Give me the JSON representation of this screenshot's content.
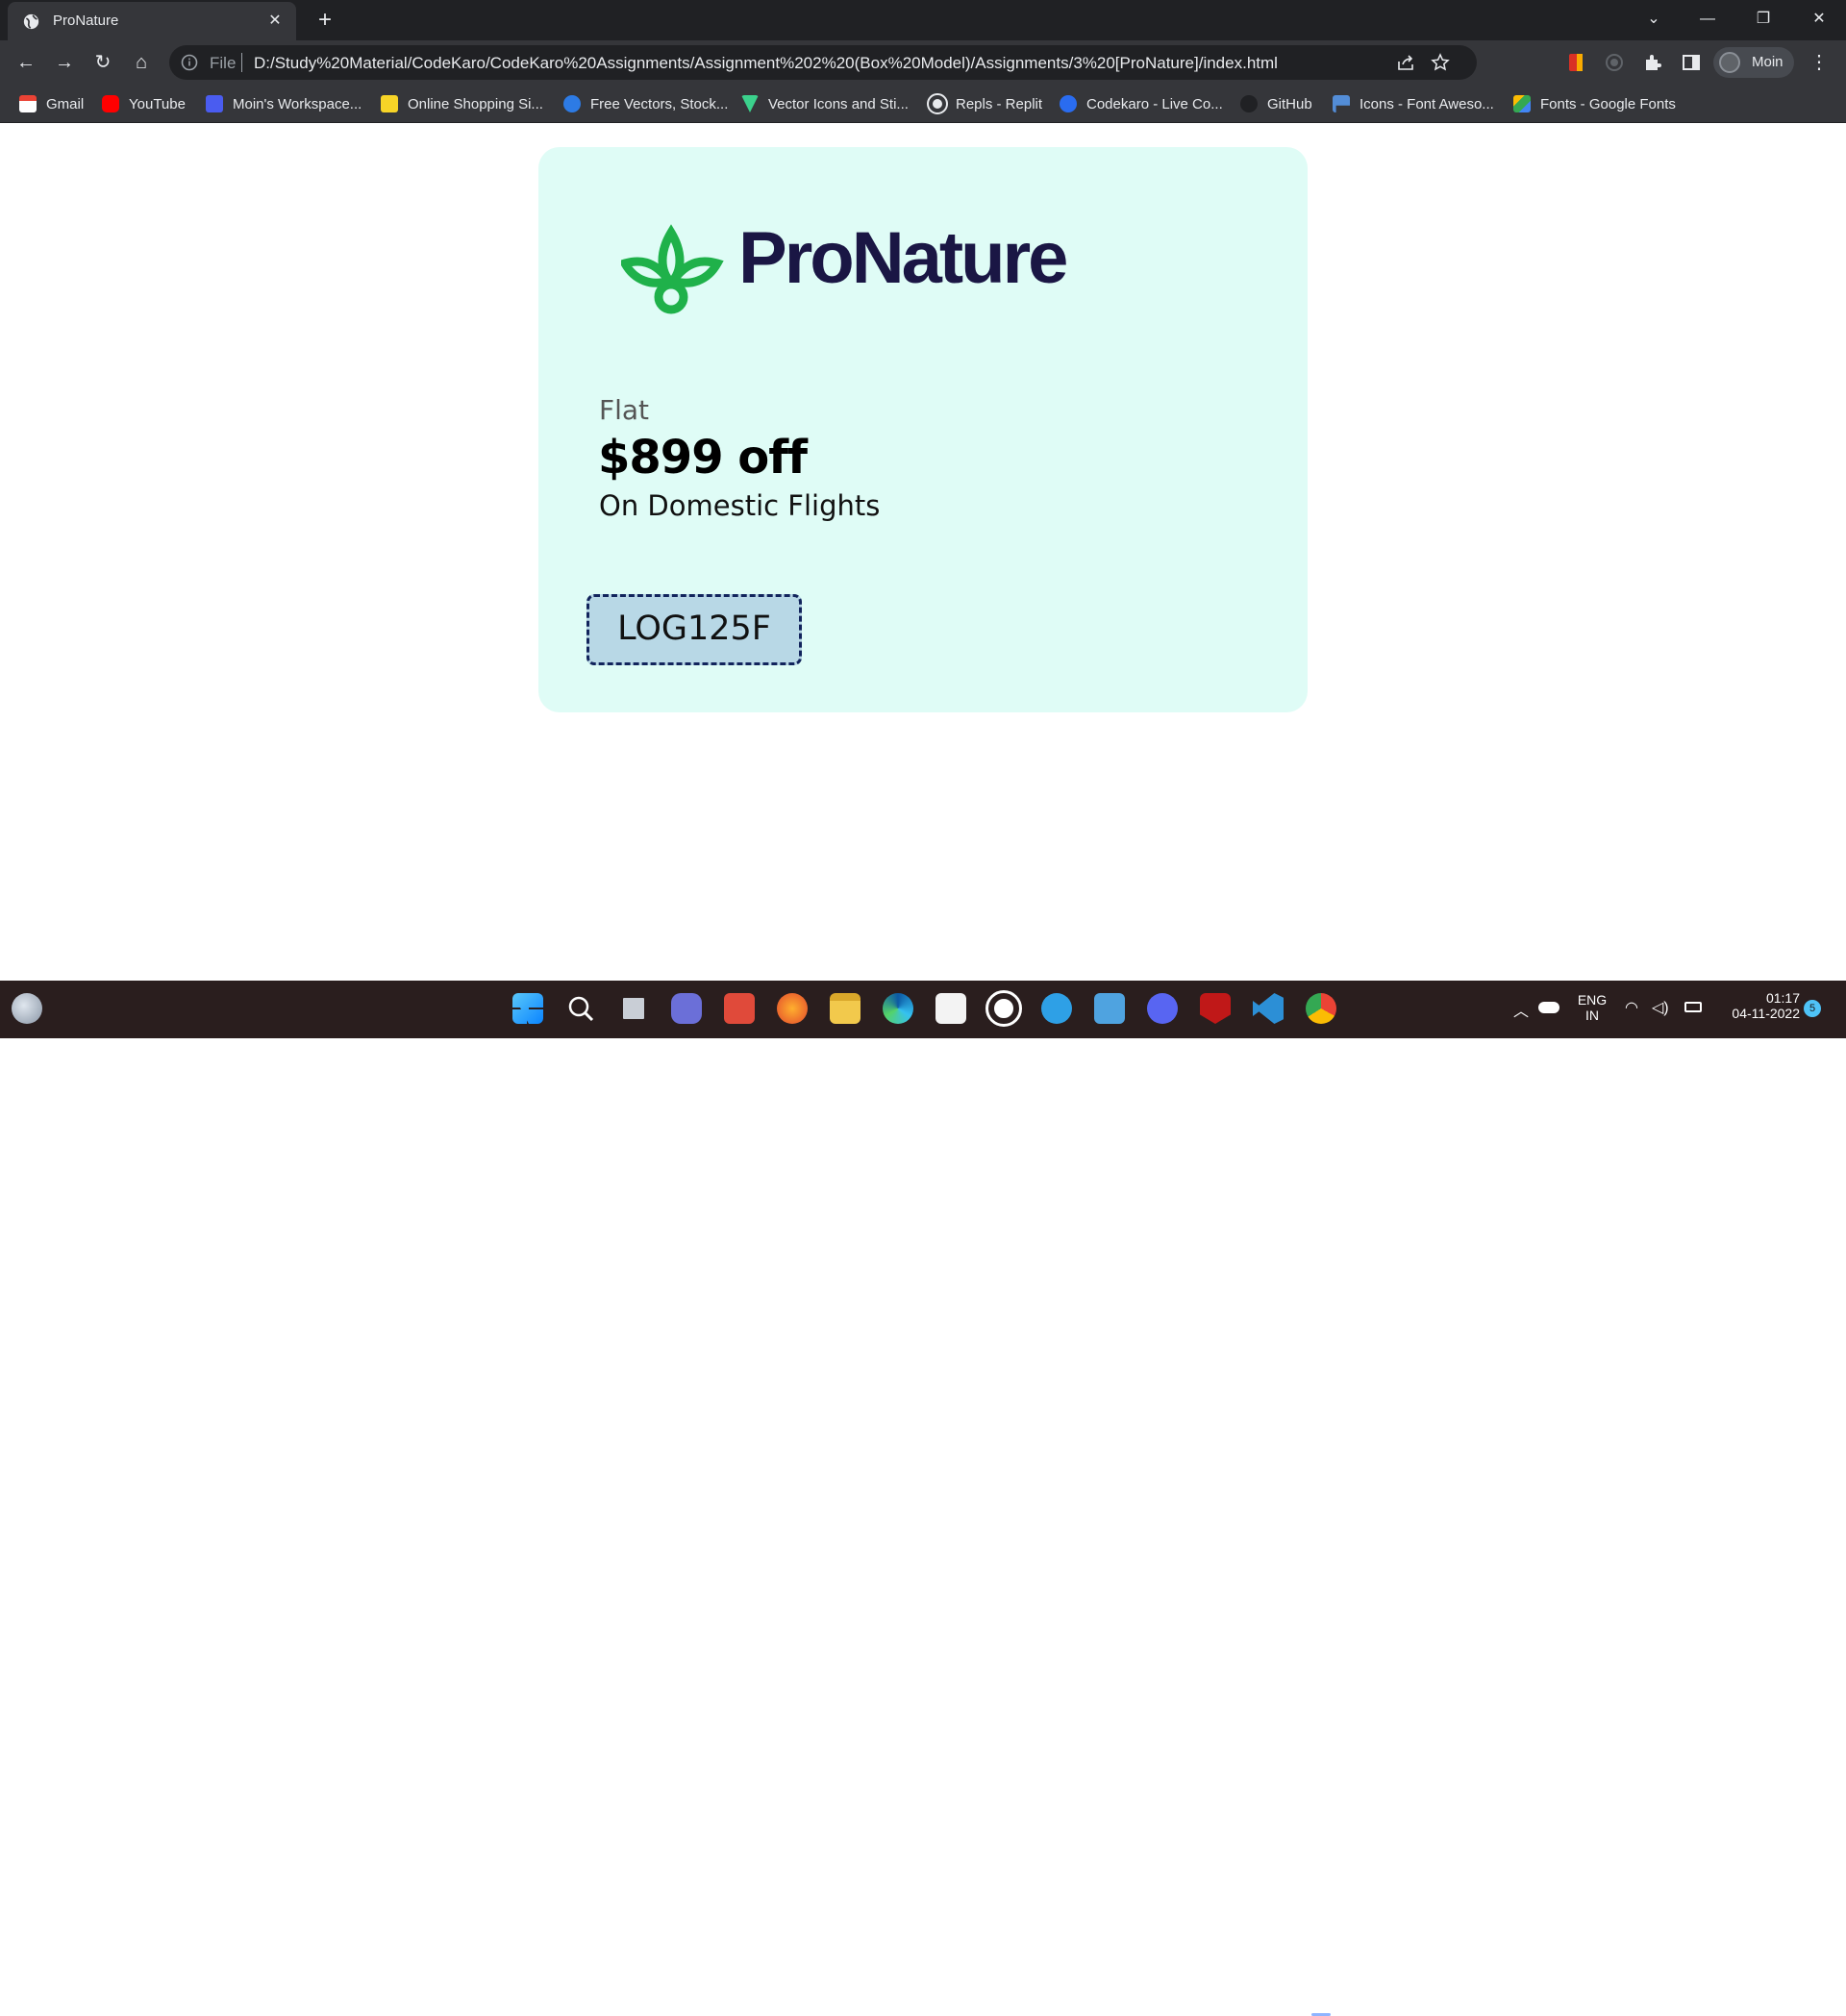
{
  "browser": {
    "tab_title": "ProNature",
    "url_scheme": "File",
    "url": "D:/Study%20Material/CodeKaro/CodeKaro%20Assignments/Assignment%202%20(Box%20Model)/Assignments/3%20[ProNature]/index.html",
    "profile_name": "Moin"
  },
  "bookmarks": [
    {
      "label": "Gmail",
      "icon": "gmail-icon",
      "color": "#ea4335"
    },
    {
      "label": "YouTube",
      "icon": "youtube-icon",
      "color": "#ff0000"
    },
    {
      "label": "Moin's Workspace...",
      "icon": "workspace-icon",
      "color": "#4a5cf0"
    },
    {
      "label": "Online Shopping Si...",
      "icon": "flipkart-icon",
      "color": "#f7d427"
    },
    {
      "label": "Free Vectors, Stock...",
      "icon": "freepik-icon",
      "color": "#2d7be5"
    },
    {
      "label": "Vector Icons and Sti...",
      "icon": "flaticon-icon",
      "color": "#3bd18c"
    },
    {
      "label": "Repls - Replit",
      "icon": "replit-icon",
      "color": "#e8eaed"
    },
    {
      "label": "Codekaro - Live Co...",
      "icon": "codekaro-icon",
      "color": "#2a6cf0"
    },
    {
      "label": "GitHub",
      "icon": "github-icon",
      "color": "#202124"
    },
    {
      "label": "Icons - Font Aweso...",
      "icon": "fontawesome-icon",
      "color": "#538dd7"
    },
    {
      "label": "Fonts - Google Fonts",
      "icon": "googlefonts-icon",
      "color": "#fbbc04"
    }
  ],
  "page": {
    "brand": "ProNature",
    "flat_label": "Flat",
    "discount": "$899 off",
    "subtitle": "On Domestic Flights",
    "coupon_code": "LOG125F",
    "colors": {
      "card_bg": "#dffcf6",
      "brand_green": "#1fb14a",
      "brand_navy": "#1a1644",
      "coupon_bg": "#b8d8e6",
      "coupon_border": "#12245c"
    }
  },
  "taskbar": {
    "apps": [
      "windows-start-icon",
      "search-icon",
      "task-view-icon",
      "teams-chat-icon",
      "power-app-icon",
      "firefox-icon",
      "file-explorer-icon",
      "edge-icon",
      "store-icon",
      "github-desktop-icon",
      "help-icon",
      "notepad-icon",
      "discord-icon",
      "mcafee-icon",
      "vscode-icon",
      "chrome-icon"
    ],
    "language": "ENG",
    "region": "IN",
    "time": "01:17",
    "date": "04-11-2022",
    "notification_count": "5"
  }
}
